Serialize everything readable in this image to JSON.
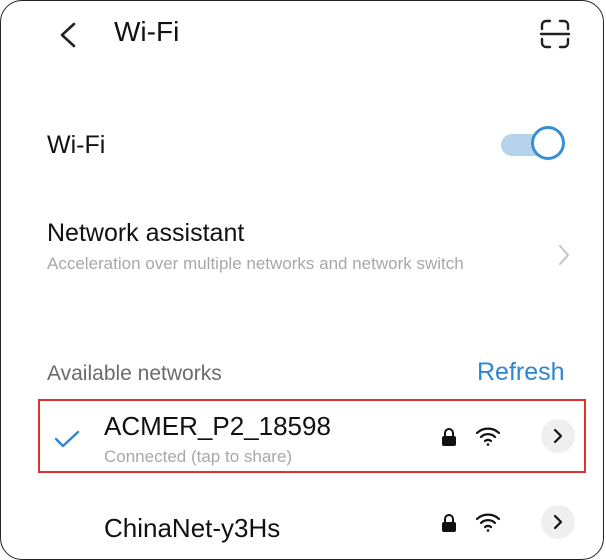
{
  "header": {
    "title": "Wi-Fi"
  },
  "wifi_toggle": {
    "label": "Wi-Fi",
    "state": "on"
  },
  "network_assistant": {
    "title": "Network assistant",
    "subtitle": "Acceleration over multiple networks and network switch"
  },
  "networks_section": {
    "label": "Available networks",
    "refresh_label": "Refresh"
  },
  "networks": [
    {
      "name": "ACMER_P2_18598",
      "status": "Connected (tap to share)",
      "secured": true,
      "connected": true
    },
    {
      "name": "ChinaNet-y3Hs",
      "secured": true,
      "connected": false
    }
  ],
  "colors": {
    "accent": "#2f86d6",
    "toggle_track": "#b6d3ec",
    "secondary_text": "#a8a8a8",
    "highlight": "#e53030"
  }
}
